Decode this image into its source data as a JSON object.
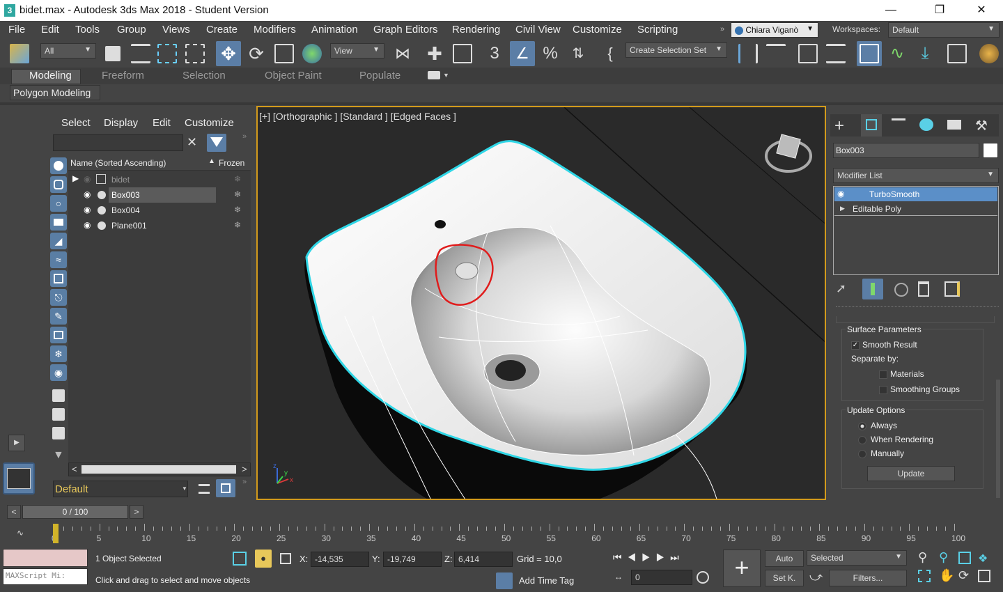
{
  "window": {
    "title": "bidet.max - Autodesk 3ds Max 2018 - Student Version",
    "app_icon": "3"
  },
  "menus": [
    "File",
    "Edit",
    "Tools",
    "Group",
    "Views",
    "Create",
    "Modifiers",
    "Animation",
    "Graph Editors",
    "Rendering",
    "Civil View",
    "Customize",
    "Scripting"
  ],
  "user": {
    "name": "Chiara Viganò",
    "workspaces_label": "Workspaces:",
    "workspace": "Default"
  },
  "toolbar": {
    "selection_filter": "All",
    "reference_coord": "View",
    "selection_set": "Create Selection Set"
  },
  "ribbon": {
    "tabs": [
      "Modeling",
      "Freeform",
      "Selection",
      "Object Paint",
      "Populate"
    ],
    "sub_tab": "Polygon Modeling"
  },
  "scene_explorer": {
    "tabs": [
      "Select",
      "Display",
      "Edit",
      "Customize"
    ],
    "search_value": "",
    "col_name": "Name (Sorted Ascending)",
    "col_frozen": "Frozen",
    "rows": [
      {
        "name": "bidet",
        "selected": false
      },
      {
        "name": "Box003",
        "selected": true
      },
      {
        "name": "Box004",
        "selected": false
      },
      {
        "name": "Plane001",
        "selected": false
      }
    ],
    "layer": "Default"
  },
  "viewport": {
    "label": "[+] [Orthographic ] [Standard ] [Edged Faces ]",
    "axis_labels": [
      "z",
      "x",
      "y"
    ]
  },
  "command_panel": {
    "object_name": "Box003",
    "modifier_list": "Modifier List",
    "stack": [
      "TurboSmooth",
      "Editable Poly"
    ],
    "surface_params_title": "Surface Parameters",
    "smooth_result": "Smooth Result",
    "separate_by": "Separate by:",
    "materials": "Materials",
    "smoothing_groups": "Smoothing Groups",
    "update_title": "Update Options",
    "always": "Always",
    "when_rendering": "When Rendering",
    "manually": "Manually",
    "update_btn": "Update"
  },
  "timeline": {
    "frame": "0 / 100",
    "ticks": [
      "0",
      "5",
      "10",
      "15",
      "20",
      "25",
      "30",
      "35",
      "40",
      "45",
      "50",
      "55",
      "60",
      "65",
      "70",
      "75",
      "80",
      "85",
      "90",
      "95",
      "100"
    ]
  },
  "status": {
    "maxscript": "MAXScript Mi:",
    "selected_count": "1 Object Selected",
    "prompt": "Click and drag to select and move objects",
    "x_label": "X:",
    "x": "-14,535",
    "y_label": "Y:",
    "y": "-19,749",
    "z_label": "Z:",
    "z": "6,414",
    "grid": "Grid = 10,0",
    "add_time_tag": "Add Time Tag",
    "auto": "Auto",
    "setk": "Set K.",
    "selected_dd": "Selected",
    "filters": "Filters...",
    "current_frame": "0"
  },
  "colors": {
    "accent": "#5a7ea4",
    "viewport_border": "#d29a1c",
    "selection_outline": "#2fd6e6",
    "highlight": "#5b7ea6"
  }
}
